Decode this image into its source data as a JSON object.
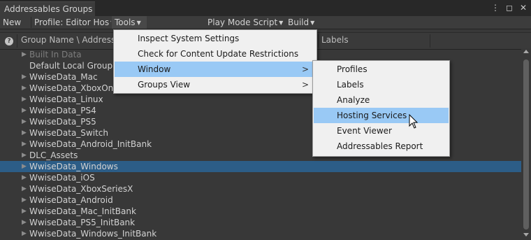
{
  "window": {
    "tab_title": "Addressables Groups",
    "icons": [
      "more-vertical-icon",
      "maximize-icon",
      "close-icon"
    ]
  },
  "toolbar": {
    "new": "New",
    "profile": "Profile: Editor Hos",
    "tools": "Tools",
    "play_mode": "Play Mode Script",
    "build": "Build"
  },
  "header": {
    "help_glyph": "?",
    "col_group": "Group Name \\ Addressab",
    "col_labels": "Labels"
  },
  "groups": [
    {
      "label": "Built In Data",
      "arrow": "▶",
      "dim": true
    },
    {
      "label": "Default Local Group (",
      "arrow": ""
    },
    {
      "label": "WwiseData_Mac",
      "arrow": "▶"
    },
    {
      "label": "WwiseData_XboxOne",
      "arrow": "▶"
    },
    {
      "label": "WwiseData_Linux",
      "arrow": "▶"
    },
    {
      "label": "WwiseData_PS4",
      "arrow": "▶"
    },
    {
      "label": "WwiseData_PS5",
      "arrow": "▶"
    },
    {
      "label": "WwiseData_Switch",
      "arrow": "▶"
    },
    {
      "label": "WwiseData_Android_InitBank",
      "arrow": "▶"
    },
    {
      "label": "DLC_Assets",
      "arrow": "▶"
    },
    {
      "label": "WwiseData_Windows",
      "arrow": "▶",
      "selected": true
    },
    {
      "label": "WwiseData_iOS",
      "arrow": "▶"
    },
    {
      "label": "WwiseData_XboxSeriesX",
      "arrow": "▶"
    },
    {
      "label": "WwiseData_Android",
      "arrow": "▶"
    },
    {
      "label": "WwiseData_Mac_InitBank",
      "arrow": "▶"
    },
    {
      "label": "WwiseData_PS5_InitBank",
      "arrow": "▶"
    },
    {
      "label": "WwiseData_Windows_InitBank",
      "arrow": "▶"
    }
  ],
  "tools_menu": {
    "items": [
      {
        "label": "Inspect System Settings",
        "submenu": false
      },
      {
        "label": "Check for Content Update Restrictions",
        "submenu": false
      },
      {
        "label": "Window",
        "submenu": true,
        "highlighted": true
      },
      {
        "label": "Groups View",
        "submenu": true
      }
    ]
  },
  "window_submenu": {
    "items": [
      {
        "label": "Profiles"
      },
      {
        "label": "Labels"
      },
      {
        "label": "Analyze"
      },
      {
        "label": "Hosting Services",
        "highlighted": true
      },
      {
        "label": "Event Viewer"
      },
      {
        "label": "Addressables Report"
      }
    ]
  },
  "submenu_glyph": ">",
  "colors": {
    "selection": "#2c5d87",
    "menu_highlight": "#99c9f5",
    "menu_bg": "#f0f0f0"
  }
}
